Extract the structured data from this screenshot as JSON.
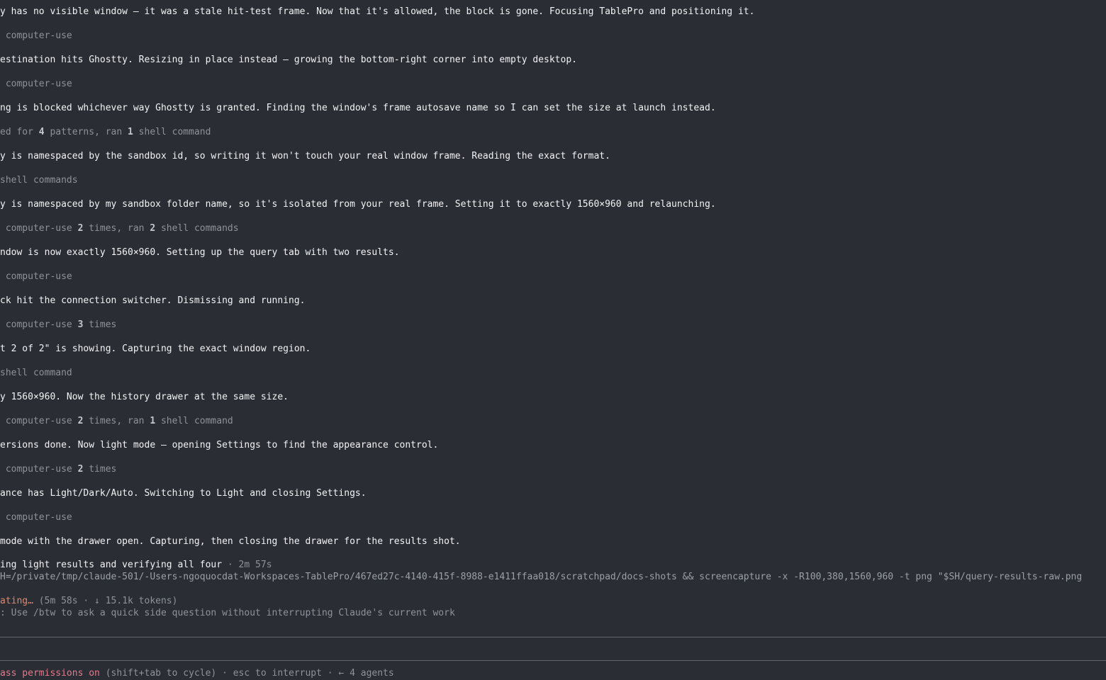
{
  "transcript": [
    {
      "kind": "msg",
      "text": "y has no visible window — it was a stale hit-test frame. Now that it's allowed, the block is gone. Focusing TablePro and positioning it."
    },
    {
      "kind": "tool",
      "pre": " computer-use",
      "n1": "",
      "mid": "",
      "n2": "",
      "post": ""
    },
    {
      "kind": "msg",
      "text": "estination hits Ghostty. Resizing in place instead — growing the bottom-right corner into empty desktop."
    },
    {
      "kind": "tool",
      "pre": " computer-use",
      "n1": "",
      "mid": "",
      "n2": "",
      "post": ""
    },
    {
      "kind": "msg",
      "text": "ng is blocked whichever way Ghostty is granted. Finding the window's frame autosave name so I can set the size at launch instead."
    },
    {
      "kind": "tool",
      "pre": "ed for ",
      "n1": "4",
      "mid": " patterns, ran ",
      "n2": "1",
      "post": " shell command"
    },
    {
      "kind": "msg",
      "text": "y is namespaced by the sandbox id, so writing it won't touch your real window frame. Reading the exact format."
    },
    {
      "kind": "tool",
      "pre": "shell commands",
      "n1": "",
      "mid": "",
      "n2": "",
      "post": ""
    },
    {
      "kind": "msg",
      "text": "y is namespaced by my sandbox folder name, so it's isolated from your real frame. Setting it to exactly 1560×960 and relaunching."
    },
    {
      "kind": "tool",
      "pre": " computer-use ",
      "n1": "2",
      "mid": " times, ran ",
      "n2": "2",
      "post": " shell commands"
    },
    {
      "kind": "msg",
      "text": "ndow is now exactly 1560×960. Setting up the query tab with two results."
    },
    {
      "kind": "tool",
      "pre": " computer-use",
      "n1": "",
      "mid": "",
      "n2": "",
      "post": ""
    },
    {
      "kind": "msg",
      "text": "ck hit the connection switcher. Dismissing and running."
    },
    {
      "kind": "tool",
      "pre": " computer-use ",
      "n1": "3",
      "mid": " times",
      "n2": "",
      "post": ""
    },
    {
      "kind": "msg",
      "text": "t 2 of 2\" is showing. Capturing the exact window region."
    },
    {
      "kind": "tool",
      "pre": "shell command",
      "n1": "",
      "mid": "",
      "n2": "",
      "post": ""
    },
    {
      "kind": "msg",
      "text": "y 1560×960. Now the history drawer at the same size."
    },
    {
      "kind": "tool",
      "pre": " computer-use ",
      "n1": "2",
      "mid": " times, ran ",
      "n2": "1",
      "post": " shell command"
    },
    {
      "kind": "msg",
      "text": "ersions done. Now light mode — opening Settings to find the appearance control."
    },
    {
      "kind": "tool",
      "pre": " computer-use ",
      "n1": "2",
      "mid": " times",
      "n2": "",
      "post": ""
    },
    {
      "kind": "msg",
      "text": "ance has Light/Dark/Auto. Switching to Light and closing Settings."
    },
    {
      "kind": "tool",
      "pre": " computer-use",
      "n1": "",
      "mid": "",
      "n2": "",
      "post": ""
    },
    {
      "kind": "msg",
      "text": "mode with the drawer open. Capturing, then closing the drawer for the results shot."
    }
  ],
  "active_task": {
    "label": "ing light results and verifying all four",
    "elapsed": " · 2m 57s"
  },
  "running_command": "H=/private/tmp/claude-501/-Users-ngoquocdat-Workspaces-TablePro/467ed27c-4140-415f-8988-e1411ffaa018/scratchpad/docs-shots && screencapture -x -R100,380,1560,960 -t png \"$SH/query-results-raw.png",
  "status": {
    "word": "ating…",
    "detail": " (5m 58s · ↓ 15.1k tokens)"
  },
  "tip": ": Use /btw to ask a quick side question without interrupting Claude's current work",
  "footer": {
    "permission": "ass permissions on",
    "hint": " (shift+tab to cycle) · esc to interrupt · ← 4 agents"
  }
}
